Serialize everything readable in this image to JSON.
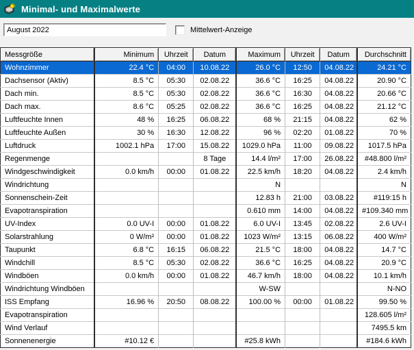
{
  "window": {
    "title": "Minimal- und Maximalwerte"
  },
  "toolbar": {
    "period_value": "August 2022",
    "checkbox_label": "Mittelwert-Anzeige",
    "checkbox_checked": false
  },
  "colors": {
    "titlebar": "#078084",
    "selection": "#0a69d2",
    "selection_text": "#ffffff",
    "window_bg": "#f1f1f1",
    "table_bg": "#ffffff"
  },
  "icons": {
    "app_icon": "weather-station-with-sun-icon"
  },
  "table": {
    "selected_row": 0,
    "columns": [
      {
        "label": "Messgröße",
        "align": "left"
      },
      {
        "label": "Minimum",
        "align": "right"
      },
      {
        "label": "Uhrzeit",
        "align": "center"
      },
      {
        "label": "Datum",
        "align": "center"
      },
      {
        "label": "Maximum",
        "align": "right"
      },
      {
        "label": "Uhrzeit",
        "align": "center"
      },
      {
        "label": "Datum",
        "align": "center"
      },
      {
        "label": "Durchschnitt",
        "align": "right"
      }
    ],
    "rows": [
      [
        "Wohnzimmer",
        "22.4 °C",
        "04:00",
        "10.08.22",
        "26.0 °C",
        "12:50",
        "04.08.22",
        "24.21 °C"
      ],
      [
        "Dachsensor (Aktiv)",
        "8.5 °C",
        "05:30",
        "02.08.22",
        "36.6 °C",
        "16:25",
        "04.08.22",
        "20.90 °C"
      ],
      [
        "Dach min.",
        "8.5 °C",
        "05:30",
        "02.08.22",
        "36.6 °C",
        "16:30",
        "04.08.22",
        "20.66 °C"
      ],
      [
        "Dach max.",
        "8.6 °C",
        "05:25",
        "02.08.22",
        "36.6 °C",
        "16:25",
        "04.08.22",
        "21.12 °C"
      ],
      [
        "Luftfeuchte Innen",
        "48 %",
        "16:25",
        "06.08.22",
        "68 %",
        "21:15",
        "04.08.22",
        "62 %"
      ],
      [
        "Luftfeuchte Außen",
        "30 %",
        "16:30",
        "12.08.22",
        "96 %",
        "02:20",
        "01.08.22",
        "70 %"
      ],
      [
        "Luftdruck",
        "1002.1 hPa",
        "17:00",
        "15.08.22",
        "1029.0 hPa",
        "11:00",
        "09.08.22",
        "1017.5 hPa"
      ],
      [
        "Regenmenge",
        "",
        "",
        "8 Tage",
        "14.4 l/m²",
        "17:00",
        "26.08.22",
        "#48.800 l/m²"
      ],
      [
        "Windgeschwindigkeit",
        "0.0 km/h",
        "00:00",
        "01.08.22",
        "22.5 km/h",
        "18:20",
        "04.08.22",
        "2.4 km/h"
      ],
      [
        "Windrichtung",
        "",
        "",
        "",
        "N",
        "",
        "",
        "N"
      ],
      [
        "Sonnenschein-Zeit",
        "",
        "",
        "",
        "12.83 h",
        "21:00",
        "03.08.22",
        "#119:15 h"
      ],
      [
        "Evapotranspiration",
        "",
        "",
        "",
        "0.610 mm",
        "14:00",
        "04.08.22",
        "#109.340 mm"
      ],
      [
        "UV-Index",
        "0.0 UV-I",
        "00:00",
        "01.08.22",
        "6.0 UV-I",
        "13:45",
        "02.08.22",
        "2.6 UV-I"
      ],
      [
        "Solarstrahlung",
        "0 W/m²",
        "00:00",
        "01.08.22",
        "1023 W/m²",
        "13:15",
        "06.08.22",
        "400 W/m²"
      ],
      [
        "Taupunkt",
        "6.8 °C",
        "16:15",
        "06.08.22",
        "21.5 °C",
        "18:00",
        "04.08.22",
        "14.7 °C"
      ],
      [
        "Windchill",
        "8.5 °C",
        "05:30",
        "02.08.22",
        "36.6 °C",
        "16:25",
        "04.08.22",
        "20.9 °C"
      ],
      [
        "Windböen",
        "0.0 km/h",
        "00:00",
        "01.08.22",
        "46.7 km/h",
        "18:00",
        "04.08.22",
        "10.1 km/h"
      ],
      [
        "Windrichtung Windböen",
        "",
        "",
        "",
        "W-SW",
        "",
        "",
        "N-NO"
      ],
      [
        "ISS Empfang",
        "16.96 %",
        "20:50",
        "08.08.22",
        "100.00 %",
        "00:00",
        "01.08.22",
        "99.50 %"
      ],
      [
        "Evapotranspiration",
        "",
        "",
        "",
        "",
        "",
        "",
        "128.605 l/m²"
      ],
      [
        "Wind Verlauf",
        "",
        "",
        "",
        "",
        "",
        "",
        "7495.5 km"
      ],
      [
        "Sonnenenergie",
        "#10.12 €",
        "",
        "",
        "#25.8 kWh",
        "",
        "",
        "#184.6 kWh"
      ]
    ]
  }
}
